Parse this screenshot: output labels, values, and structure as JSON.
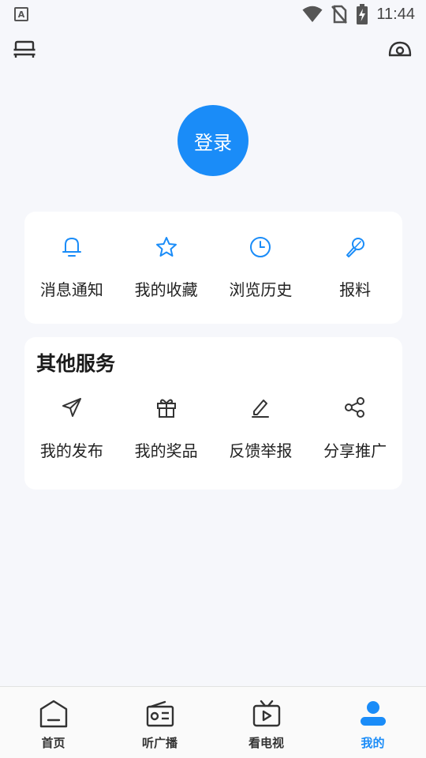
{
  "status_bar": {
    "app_letter": "A",
    "time": "11:44"
  },
  "header": {
    "left_icon": "bed-icon",
    "right_icon": "cap-icon"
  },
  "login": {
    "label": "登录"
  },
  "quick_actions": [
    {
      "label": "消息通知",
      "icon": "bell-icon"
    },
    {
      "label": "我的收藏",
      "icon": "star-icon"
    },
    {
      "label": "浏览历史",
      "icon": "clock-icon"
    },
    {
      "label": "报料",
      "icon": "microphone-icon"
    }
  ],
  "other_services": {
    "title": "其他服务",
    "items": [
      {
        "label": "我的发布",
        "icon": "paper-plane-icon"
      },
      {
        "label": "我的奖品",
        "icon": "gift-icon"
      },
      {
        "label": "反馈举报",
        "icon": "edit-icon"
      },
      {
        "label": "分享推广",
        "icon": "share-icon"
      }
    ]
  },
  "tabbar": {
    "tabs": [
      {
        "label": "首页",
        "icon": "home-icon",
        "active": false
      },
      {
        "label": "听广播",
        "icon": "radio-icon",
        "active": false
      },
      {
        "label": "看电视",
        "icon": "tv-icon",
        "active": false
      },
      {
        "label": "我的",
        "icon": "user-icon",
        "active": true
      }
    ]
  },
  "colors": {
    "accent": "#1a8cf8",
    "background": "#f6f7fb",
    "card": "#ffffff",
    "text": "#222222"
  }
}
